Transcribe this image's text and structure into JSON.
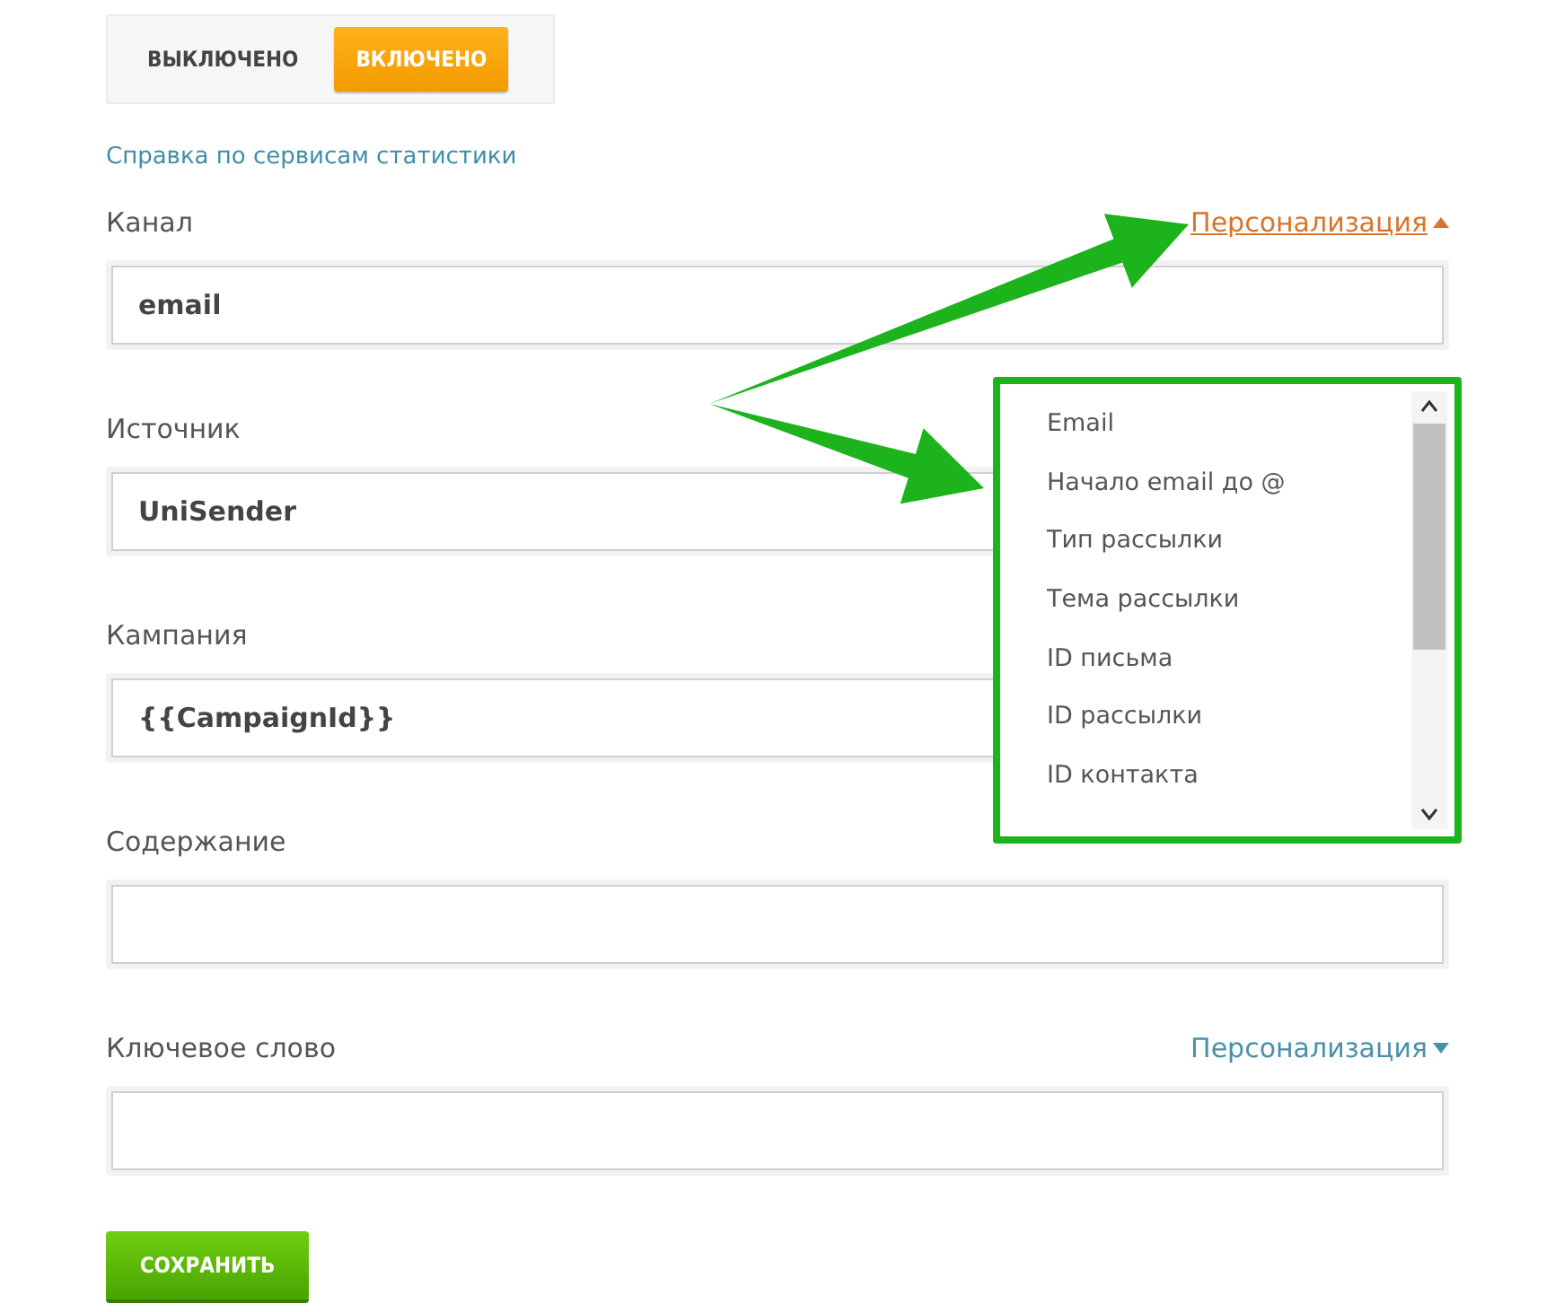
{
  "tracking_toggle": [
    {
      "label": "ВЫКЛЮЧЕНО",
      "selected": false
    },
    {
      "label": "ВКЛЮЧЕНО",
      "selected": true
    }
  ],
  "help_link": "Справка по сервисам статистики",
  "fields": [
    {
      "label": "Канал",
      "value": "email",
      "personalization": {
        "label": "Персонализация",
        "expanded": true
      }
    },
    {
      "label": "Источник",
      "value": "UniSender"
    },
    {
      "label": "Кампания",
      "value": "{{CampaignId}}"
    },
    {
      "label": "Содержание"
    },
    {
      "label": "Ключевое слово",
      "personalization": {
        "label": "Персонализация",
        "expanded": false
      }
    }
  ],
  "personalization_menu": {
    "items": [
      "Email",
      "Начало email до @",
      "Тип рассылки",
      "Тема рассылки",
      "ID письма",
      "ID рассылки",
      "ID контакта"
    ]
  },
  "save_button": "СОХРАНИТЬ"
}
